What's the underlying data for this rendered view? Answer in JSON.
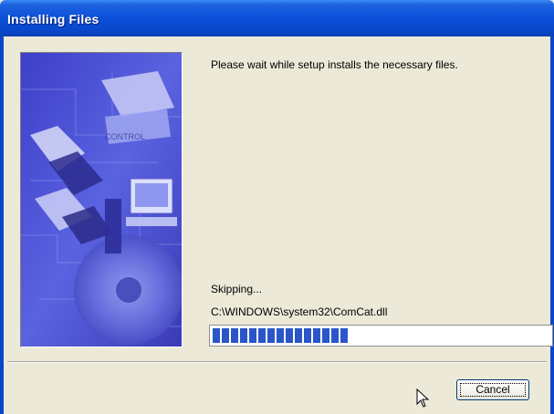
{
  "window": {
    "title": "Installing Files"
  },
  "main": {
    "message": "Please wait while setup installs the necessary files.",
    "status": "Skipping...",
    "file_path": "C:\\WINDOWS\\system32\\ComCat.dll",
    "progress": {
      "segments_filled": 15,
      "color": "#2A56C8"
    }
  },
  "buttons": {
    "cancel_label": "Cancel"
  },
  "icons": {
    "cursor": "mouse-pointer-icon",
    "art": "setup-banner-image"
  },
  "colors": {
    "titlebar": "#0A4FD8",
    "background": "#ECE9D8"
  }
}
